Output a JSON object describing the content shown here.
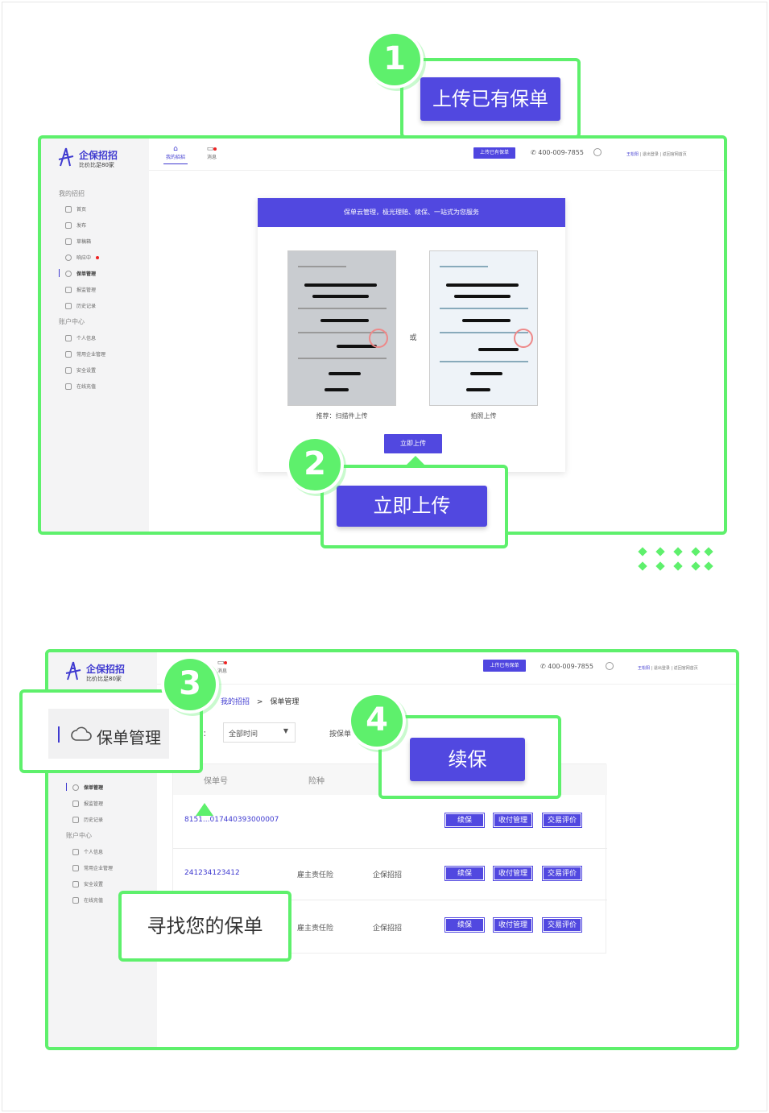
{
  "callouts": {
    "c1": {
      "num": "1",
      "label": "上传已有保单"
    },
    "c2": {
      "num": "2",
      "label": "立即上传"
    },
    "c3": {
      "num": "3",
      "label": "保单管理"
    },
    "c4": {
      "num": "4",
      "label": "续保"
    },
    "find": "寻找您的保单"
  },
  "brand": {
    "name": "企保招招",
    "slogan": "比价比足80家"
  },
  "top": {
    "tab_mine": "我的招招",
    "tab_msg": "消息",
    "upload_btn": "上传已有保单",
    "phone": "400-009-7855",
    "user": "王松阳",
    "logout": "退出登录",
    "home": "返回官网首页",
    "sep": "|"
  },
  "sidebar": {
    "group1": "我的招招",
    "items1": [
      "首页",
      "发布",
      "草稿箱",
      "响应中",
      "保单管理",
      "报监管理",
      "历史记录"
    ],
    "group2": "账户中心",
    "items2": [
      "个人信息",
      "常用企业管理",
      "安全设置",
      "在线充值"
    ]
  },
  "upload_card": {
    "header": "保单云管理，极光理赔、续保、一站式为您服务",
    "or": "或",
    "caption_scan": "推荐：扫描件上传",
    "caption_photo": "拍照上传",
    "btn": "立即上传"
  },
  "policy_page": {
    "breadcrumb_root": "我的招招",
    "breadcrumb_sep": ">",
    "breadcrumb_current": "保单管理",
    "filter_colon": "：",
    "time_select": "全部时间",
    "search_label": "按保单",
    "headers": {
      "policy_no": "保单号",
      "type": "险种"
    },
    "rows": [
      {
        "no": "8151...017440393000007",
        "type": "",
        "org": ""
      },
      {
        "no": "241234123412",
        "type": "雇主责任险",
        "org": "企保招招"
      },
      {
        "no": "",
        "type": "雇主责任险",
        "org": "企保招招"
      }
    ],
    "actions": [
      "续保",
      "收付管理",
      "交易评价"
    ]
  },
  "colors": {
    "accent": "#5148e0",
    "highlight": "#5ef06c"
  }
}
